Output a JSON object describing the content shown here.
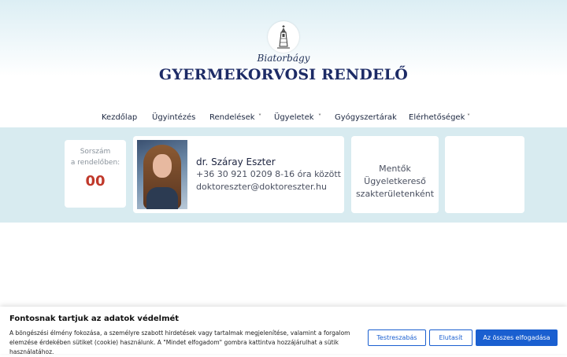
{
  "site": {
    "subtitle": "Biatorbágy",
    "title": "GYERMEKORVOSI RENDELŐ",
    "logo_icon": "church-tower-icon"
  },
  "nav": {
    "items": [
      {
        "label": "Kezdőlap",
        "has_dropdown": false
      },
      {
        "label": "Ügyintézés",
        "has_dropdown": false
      },
      {
        "label": "Rendelések",
        "has_dropdown": true
      },
      {
        "label": "Ügyeletek",
        "has_dropdown": true
      },
      {
        "label": "Gyógyszertárak",
        "has_dropdown": false
      },
      {
        "label": "Elérhetőségek",
        "has_dropdown": true
      }
    ],
    "caret_glyph": "˅"
  },
  "queue": {
    "label_line1": "Sorszám",
    "label_line2": "a rendelőben:",
    "number": "00",
    "number_color": "#c0392b"
  },
  "doctor": {
    "name": "dr. Száray Eszter",
    "phone": "+36 30 921 0209 8-16 óra között",
    "email": "doktoreszter@doktoreszter.hu"
  },
  "emergency": {
    "lines": [
      "Mentők",
      "Ügyeletkereső",
      "szakterületenként"
    ]
  },
  "cookie": {
    "title": "Fontosnak tartjuk az adatok védelmét",
    "text": "A böngészési élmény fokozása, a személyre szabott hirdetések vagy tartalmak megjelenítése, valamint a forgalom elemzése érdekében sütiket (cookie) használunk. A \"Mindet elfogadom\" gombra kattintva hozzájárulhat a sütik használatához.",
    "customize_label": "Testreszabás",
    "reject_label": "Elutasít",
    "accept_label": "Az összes elfogadása",
    "accent_color": "#1a5fd0"
  }
}
